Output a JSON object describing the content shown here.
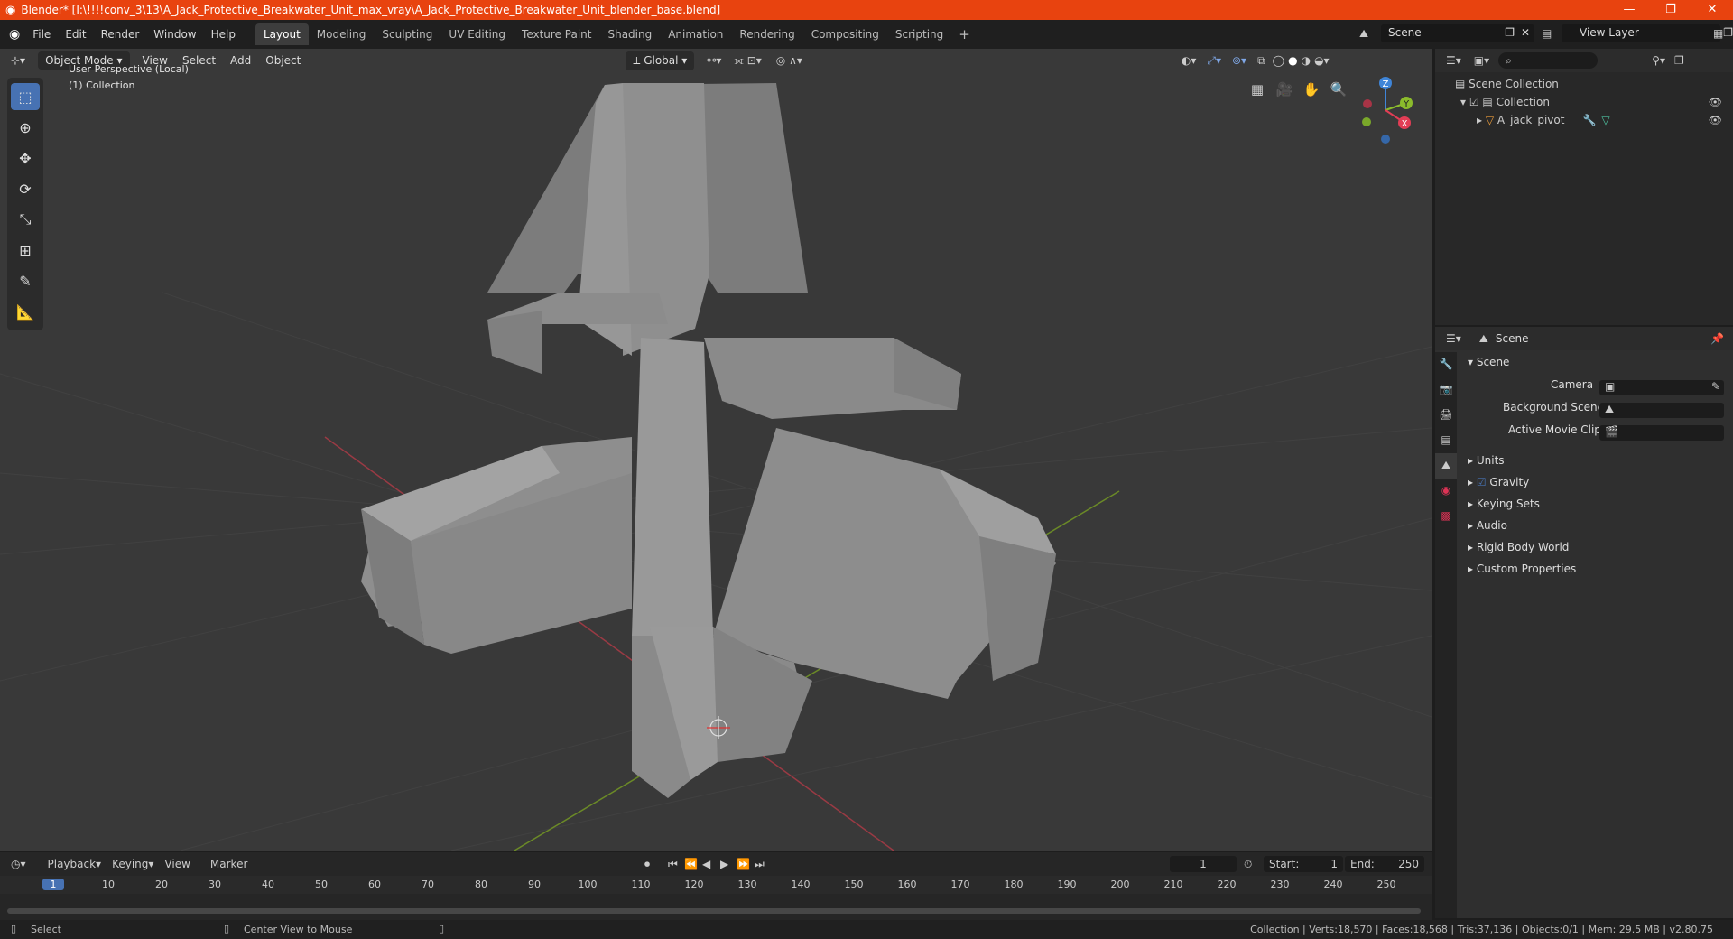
{
  "window": {
    "title": "Blender* [I:\\!!!!conv_3\\13\\A_Jack_Protective_Breakwater_Unit_max_vray\\A_Jack_Protective_Breakwater_Unit_blender_base.blend]",
    "minimize": "—",
    "maximize": "❐",
    "close": "✕"
  },
  "menus": [
    "File",
    "Edit",
    "Render",
    "Window",
    "Help"
  ],
  "workspace_tabs": [
    "Layout",
    "Modeling",
    "Sculpting",
    "UV Editing",
    "Texture Paint",
    "Shading",
    "Animation",
    "Rendering",
    "Compositing",
    "Scripting"
  ],
  "active_workspace": "Layout",
  "add_tab": "+",
  "scene_selector": "Scene",
  "view_layer": "View Layer",
  "viewport": {
    "mode": "Object Mode",
    "menus": [
      "View",
      "Select",
      "Add",
      "Object"
    ],
    "orientation": "Global",
    "overlay_line1": "User Perspective (Local)",
    "overlay_line2": "(1) Collection",
    "gizmo_axes": {
      "x": "X",
      "y": "Y",
      "z": "Z"
    }
  },
  "outliner": {
    "root": "Scene Collection",
    "collection": "Collection",
    "object": "A_jack_pivot"
  },
  "properties": {
    "header": "Scene",
    "panel": "Scene",
    "fields": {
      "camera": "Camera",
      "background_scene": "Background Scene",
      "active_movie_clip": "Active Movie Clip"
    },
    "subpanels": [
      "Units",
      "Gravity",
      "Keying Sets",
      "Audio",
      "Rigid Body World",
      "Custom Properties"
    ]
  },
  "timeline": {
    "menus": [
      "Playback",
      "Keying",
      "View",
      "Marker"
    ],
    "current_frame": "1",
    "start_label": "Start:",
    "start": "1",
    "end_label": "End:",
    "end": "250",
    "ruler": [
      "1",
      "10",
      "20",
      "30",
      "40",
      "50",
      "60",
      "70",
      "80",
      "90",
      "100",
      "110",
      "120",
      "130",
      "140",
      "150",
      "160",
      "170",
      "180",
      "190",
      "200",
      "210",
      "220",
      "230",
      "240",
      "250"
    ]
  },
  "statusbar": {
    "left": "Select",
    "middle": "Center View to Mouse",
    "right": "Collection | Verts:18,570 | Faces:18,568 | Tris:37,136 | Objects:0/1 | Mem: 29.5 MB | v2.80.75"
  },
  "colors": {
    "accent": "#4772b3",
    "titlebar": "#e8430f",
    "axis_x": "#e23d55",
    "axis_y": "#8bbb2c",
    "axis_z": "#3f85d8"
  }
}
